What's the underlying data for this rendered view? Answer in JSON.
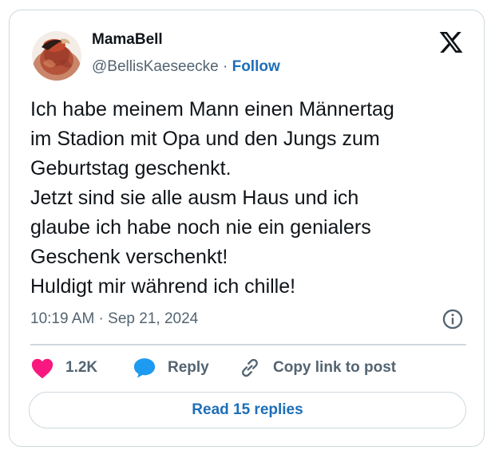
{
  "author": {
    "display_name": "MamaBell",
    "handle": "@BellisKaeseecke",
    "separator": "·",
    "follow_label": "Follow"
  },
  "tweet": {
    "lines": [
      "Ich habe meinem Mann einen Männertag",
      "im Stadion mit Opa und den Jungs zum",
      "Geburtstag geschenkt.",
      "Jetzt sind sie alle ausm Haus und ich",
      "glaube ich habe noch nie ein genialers",
      "Geschenk verschenkt!",
      "Huldigt mir während ich chille!"
    ],
    "timestamp": "10:19 AM · Sep 21, 2024"
  },
  "actions": {
    "like_count": "1.2K",
    "reply_label": "Reply",
    "copy_link_label": "Copy link to post"
  },
  "read_replies_label": "Read 15 replies",
  "icons": {
    "brand": "x-logo-icon",
    "like": "heart-icon",
    "reply": "speech-bubble-icon",
    "copy": "link-icon",
    "info": "info-icon"
  },
  "colors": {
    "like": "#f91880",
    "reply": "#1d9bf0",
    "link": "#1d6fb8",
    "muted": "#536471",
    "border": "#cfd9de"
  }
}
